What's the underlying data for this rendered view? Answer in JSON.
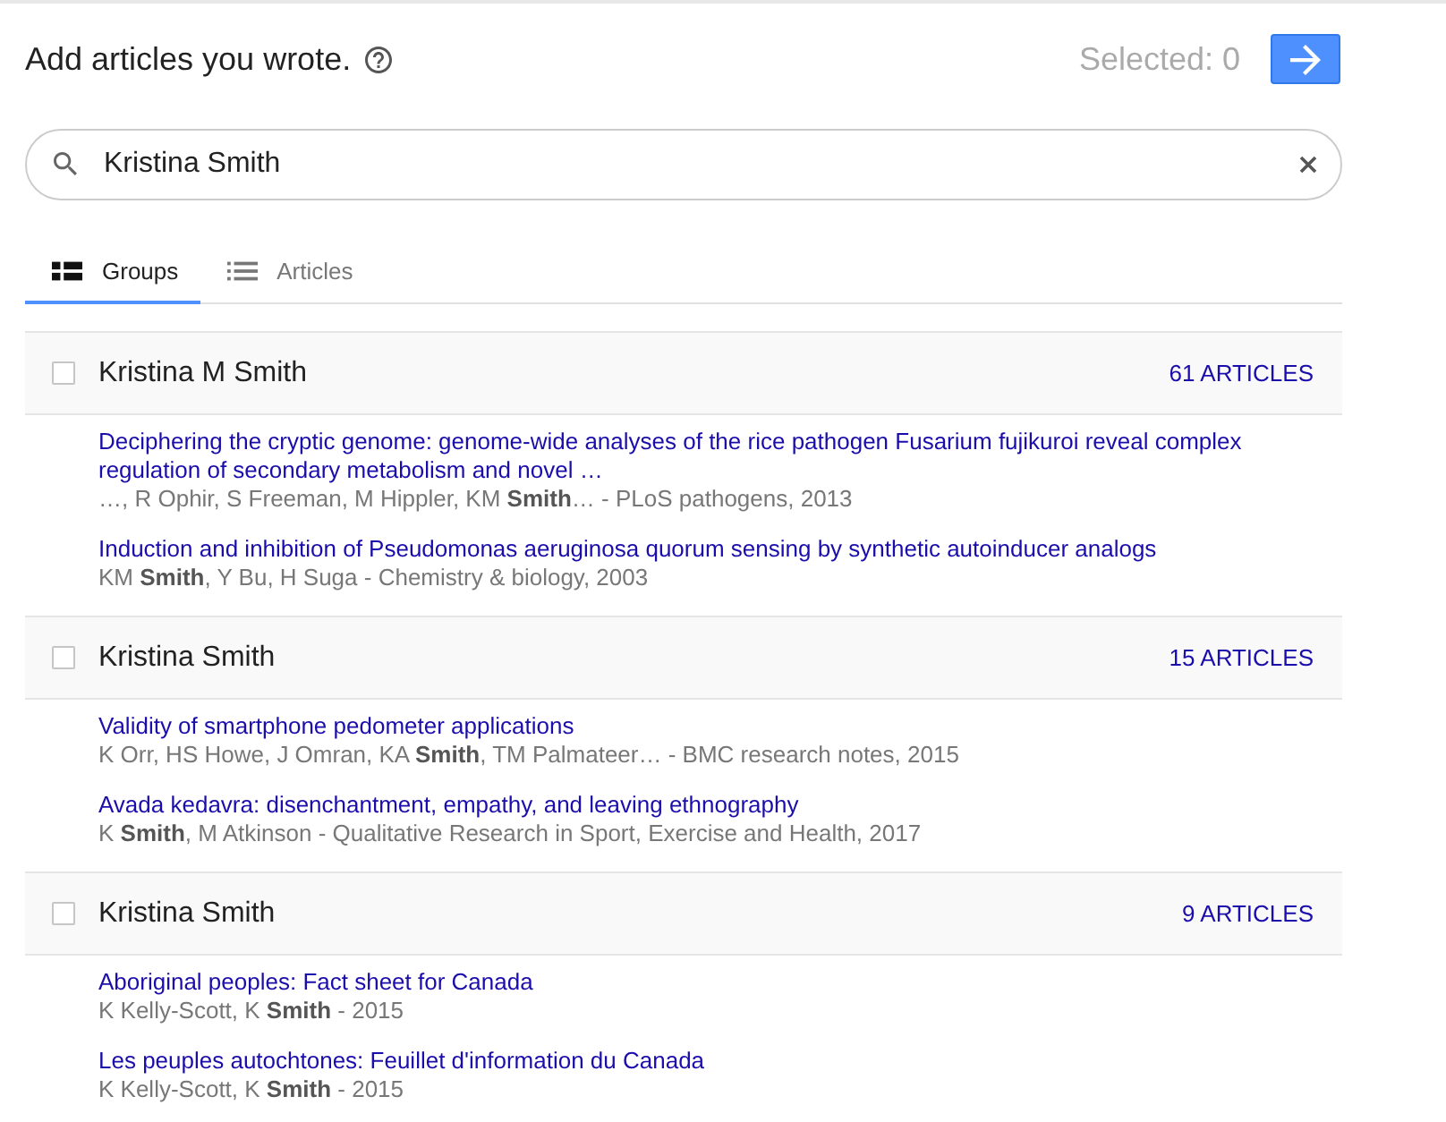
{
  "header": {
    "title": "Add articles you wrote.",
    "selected_count": "Selected: 0"
  },
  "search": {
    "value": "Kristina Smith"
  },
  "tabs": [
    {
      "label": "Groups",
      "kind": "groups",
      "selected": true
    },
    {
      "label": "Articles",
      "kind": "list",
      "selected": false
    }
  ],
  "groups": [
    {
      "name": "Kristina M Smith",
      "checked": false,
      "count": "61 ARTICLES",
      "articles": [
        {
          "title": "Deciphering the cryptic genome: genome-wide analyses of the rice pathogen Fusarium fujikuroi reveal complex regulation of secondary metabolism and novel …",
          "authors": "…, R Ophir, S Freeman, M Hippler, KM **Smith**… - PLoS pathogens, 2013"
        },
        {
          "title": "Induction and inhibition of Pseudomonas aeruginosa quorum sensing by synthetic autoinducer analogs",
          "authors": "KM **Smith**, Y Bu, H Suga - Chemistry & biology, 2003"
        }
      ]
    },
    {
      "name": "Kristina Smith",
      "checked": false,
      "count": "15 ARTICLES",
      "articles": [
        {
          "title": "Validity of smartphone pedometer applications",
          "authors": "K Orr, HS Howe, J Omran, KA **Smith**, TM Palmateer… - BMC research notes, 2015"
        },
        {
          "title": "Avada kedavra: disenchantment, empathy, and leaving ethnography",
          "authors": "K **Smith**, M Atkinson - Qualitative Research in Sport, Exercise and Health, 2017"
        }
      ]
    },
    {
      "name": "Kristina Smith",
      "checked": false,
      "count": "9 ARTICLES",
      "articles": [
        {
          "title": "Aboriginal peoples: Fact sheet for Canada",
          "authors": "K Kelly-Scott, K **Smith** - 2015"
        },
        {
          "title": "Les peuples autochtones: Feuillet d'information du Canada",
          "authors": "K Kelly-Scott, K **Smith** - 2015"
        }
      ]
    }
  ]
}
